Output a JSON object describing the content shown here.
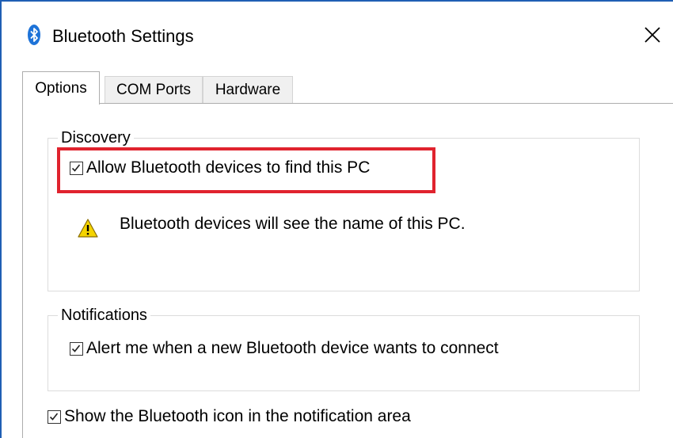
{
  "window": {
    "title": "Bluetooth Settings",
    "icon": "bluetooth-icon",
    "close_icon": "close-icon"
  },
  "tabs": [
    {
      "label": "Options",
      "active": true
    },
    {
      "label": "COM Ports",
      "active": false
    },
    {
      "label": "Hardware",
      "active": false
    }
  ],
  "discovery": {
    "legend": "Discovery",
    "allow_label": "Allow Bluetooth devices to find this PC",
    "allow_checked": true,
    "warning_icon": "warning-icon",
    "warning_text": "Bluetooth devices will see the name of this PC."
  },
  "notifications": {
    "legend": "Notifications",
    "alert_label": "Alert me when a new Bluetooth device wants to connect",
    "alert_checked": true
  },
  "show_icon": {
    "label": "Show the Bluetooth icon in the notification area",
    "checked": true
  },
  "colors": {
    "window_border": "#1f5fb4",
    "highlight": "#e0232e",
    "bluetooth_blue": "#1e73d8",
    "warning_yellow": "#f5d400"
  }
}
